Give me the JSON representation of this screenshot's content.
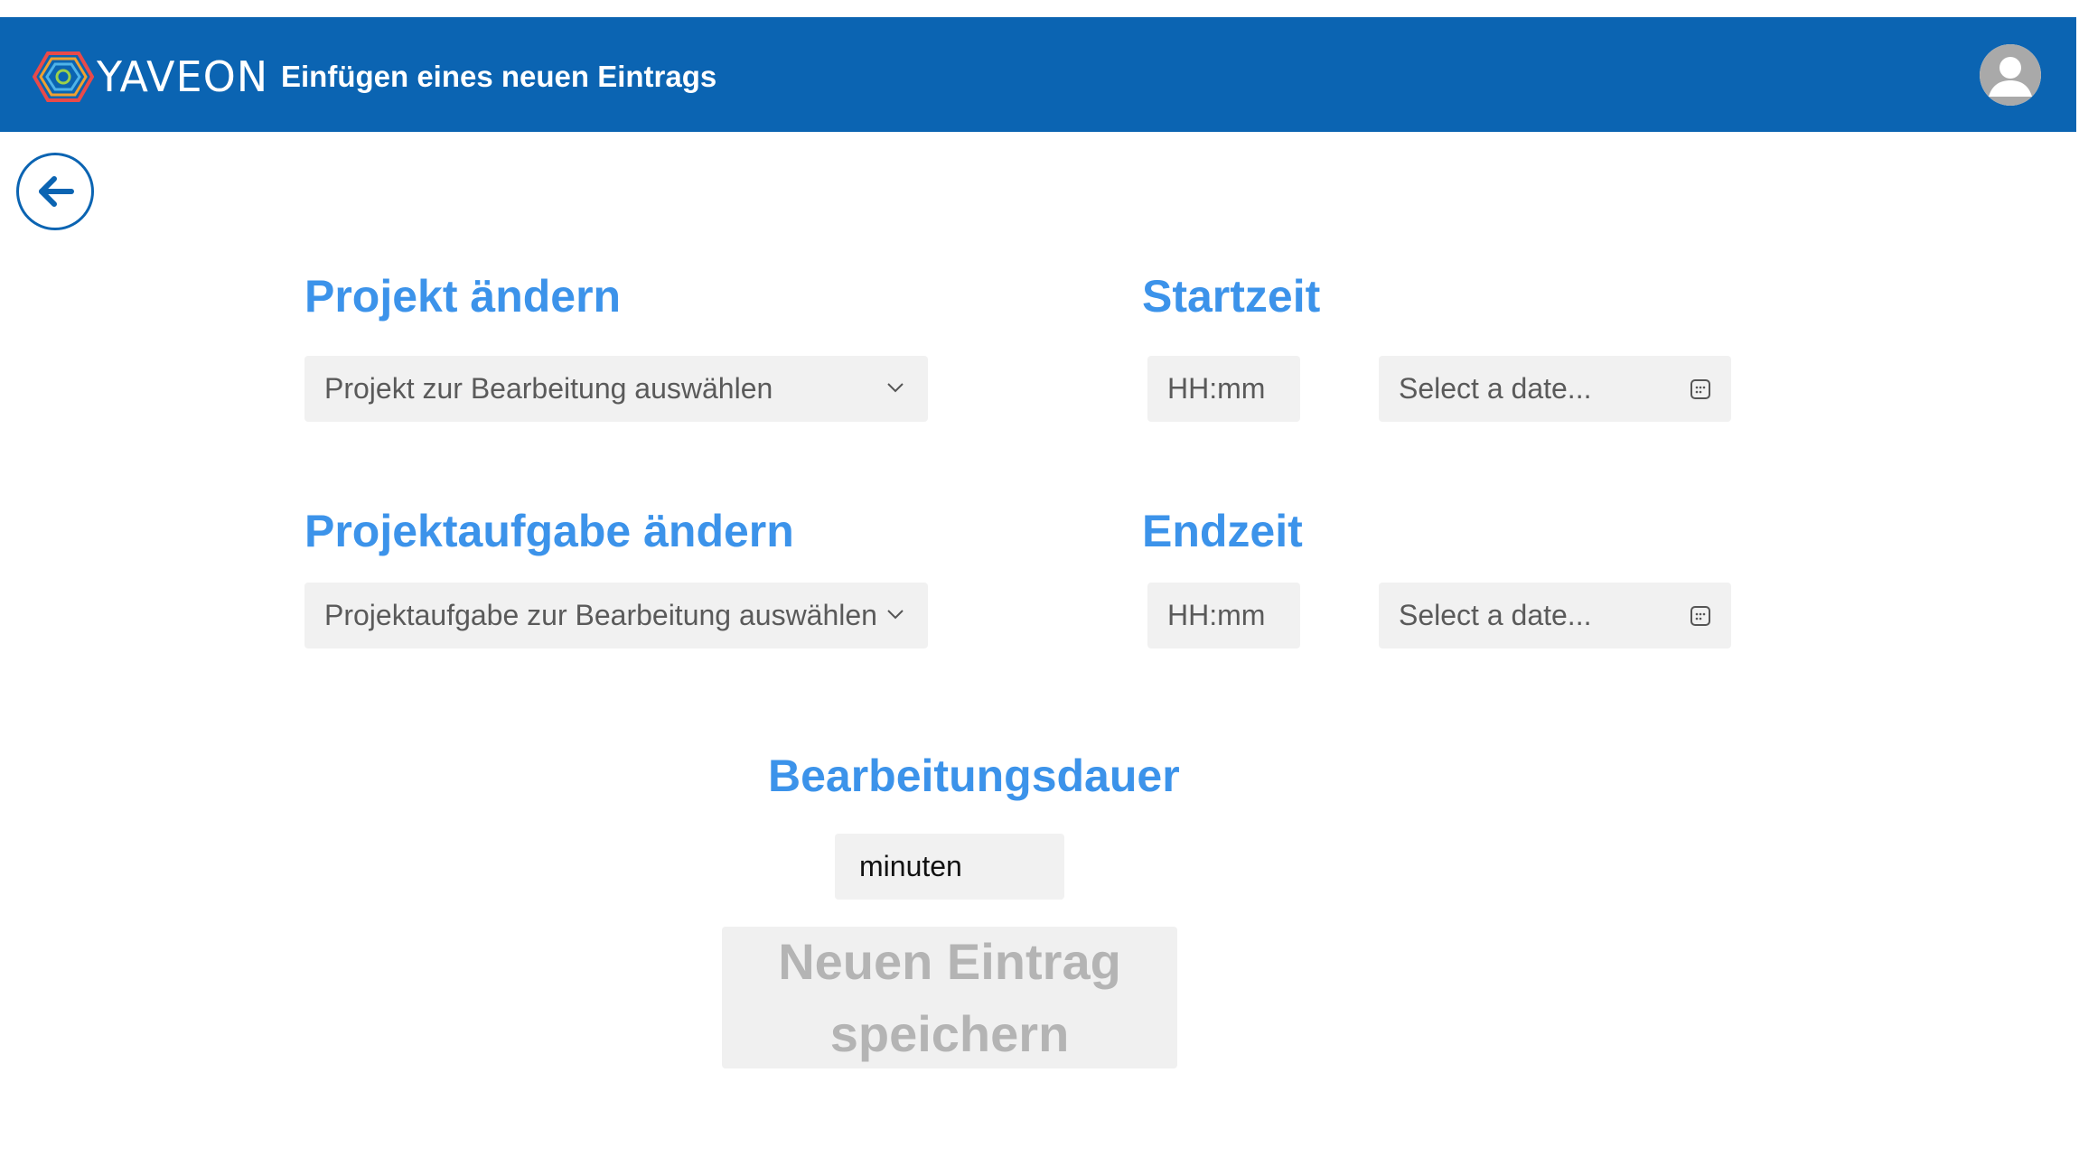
{
  "header": {
    "brand": "YAVEON",
    "title": "Einfügen eines neuen Eintrags",
    "logo_icon": "hexagon-logo-icon",
    "avatar_icon": "user-avatar-icon",
    "color": "#0b64b2"
  },
  "back_button": {
    "icon": "arrow-left-icon"
  },
  "project": {
    "title": "Projekt ändern",
    "select_value": "Projekt zur Bearbeitung auswählen"
  },
  "task": {
    "title": "Projektaufgabe ändern",
    "select_value": "Projektaufgabe zur Bearbeitung auswählen"
  },
  "start": {
    "title": "Startzeit",
    "time_placeholder": "HH:mm",
    "date_placeholder": "Select a date..."
  },
  "end": {
    "title": "Endzeit",
    "time_placeholder": "HH:mm",
    "date_placeholder": "Select a date..."
  },
  "duration": {
    "title": "Bearbeitungsdauer",
    "value": "minuten"
  },
  "save_button": {
    "label": "Neuen Eintrag speichern"
  },
  "colors": {
    "accent": "#3c93ea",
    "field_bg": "#f1f1f1",
    "disabled_text": "#b4b4b4"
  }
}
